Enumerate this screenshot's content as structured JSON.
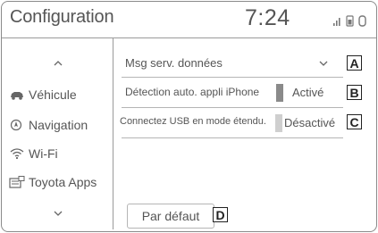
{
  "header": {
    "title": "Configuration",
    "clock": "7:24"
  },
  "nav": {
    "items": [
      {
        "label": "Véhicule",
        "icon": "car-icon"
      },
      {
        "label": "Navigation",
        "icon": "navigation-icon"
      },
      {
        "label": "Wi-Fi",
        "icon": "wifi-icon"
      },
      {
        "label": "Toyota Apps",
        "icon": "apps-icon"
      }
    ]
  },
  "settings": {
    "rows": [
      {
        "label": "Msg serv. données",
        "callout": "A"
      },
      {
        "label": "Détection auto. appli iPhone",
        "value": "Activé",
        "state": true,
        "callout": "B"
      },
      {
        "label": "Connectez USB en mode étendu.",
        "value": "Désactivé",
        "state": false,
        "callout": "C"
      }
    ]
  },
  "default_button": {
    "label": "Par défaut",
    "callout": "D"
  },
  "colors": {
    "toggle_on": "#8a8a8a",
    "toggle_off": "#cfcfcf",
    "border": "#9a9a9a"
  }
}
